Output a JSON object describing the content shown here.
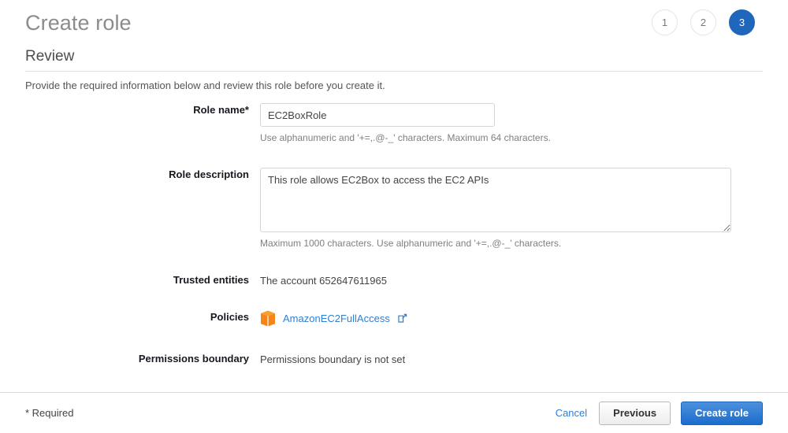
{
  "header": {
    "title": "Create role",
    "steps": [
      {
        "label": "1",
        "state": "inactive"
      },
      {
        "label": "2",
        "state": "inactive"
      },
      {
        "label": "3",
        "state": "active"
      }
    ]
  },
  "section": {
    "title": "Review",
    "description": "Provide the required information below and review this role before you create it."
  },
  "form": {
    "role_name": {
      "label": "Role name*",
      "value": "EC2BoxRole",
      "placeholder": "",
      "hint": "Use alphanumeric and '+=,.@-_' characters. Maximum 64 characters."
    },
    "role_description": {
      "label": "Role description",
      "value": "This role allows EC2Box to access the EC2 APIs",
      "placeholder": "",
      "hint": "Maximum 1000 characters. Use alphanumeric and '+=,.@-_' characters."
    },
    "trusted_entities": {
      "label": "Trusted entities",
      "value": "The account 652647611965"
    },
    "policies": {
      "label": "Policies",
      "items": [
        {
          "name": "AmazonEC2FullAccess",
          "icon": "policy-cube-icon",
          "external_link_icon": "external-link-icon"
        }
      ]
    },
    "permissions_boundary": {
      "label": "Permissions boundary",
      "value": "Permissions boundary is not set"
    }
  },
  "footer": {
    "required_note": "* Required",
    "cancel_label": "Cancel",
    "previous_label": "Previous",
    "create_label": "Create role"
  },
  "colors": {
    "accent_blue": "#1f66bd",
    "link_blue": "#2e7fd4",
    "policy_orange": "#f58518",
    "title_gray": "#8c8c8c"
  }
}
